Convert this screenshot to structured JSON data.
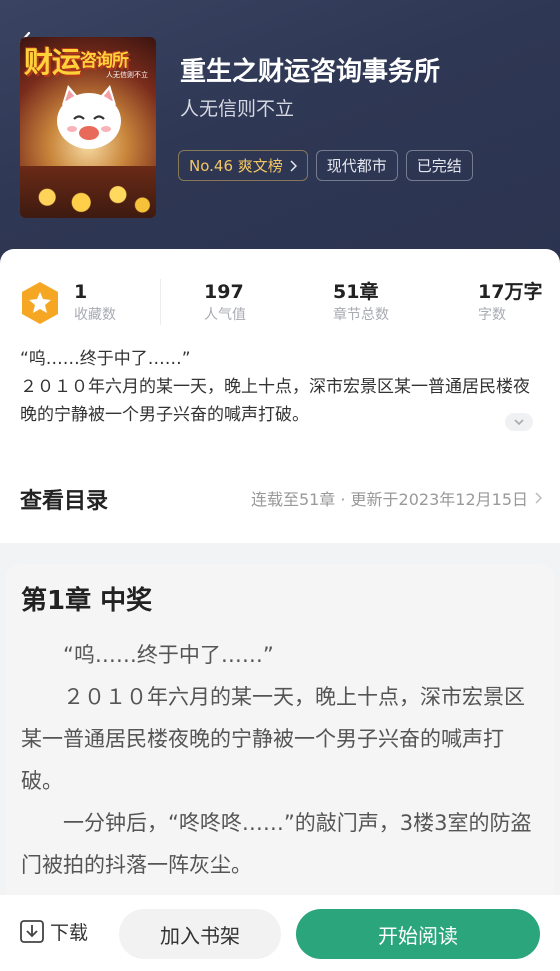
{
  "book": {
    "title": "重生之财运咨询事务所",
    "subtitle": "人无信则不立",
    "cover_title_main": "财运",
    "cover_title_small": "咨询所",
    "cover_tagline": "人无信则不立"
  },
  "tags": {
    "rank": "No.46 爽文榜",
    "genre": "现代都市",
    "status": "已完结"
  },
  "stats": {
    "favorites_value": "1",
    "favorites_label": "收藏数",
    "popularity_value": "197",
    "popularity_label": "人气值",
    "chapters_value": "51章",
    "chapters_label": "章节总数",
    "words_value": "17万字",
    "words_label": "字数"
  },
  "intro": {
    "line1": "“呜……终于中了……”",
    "line2": "２０１０年六月的某一天，晚上十点，深市宏景区某一普通居民楼夜晚的宁静被一个男子兴奋的喊声打破。"
  },
  "toc": {
    "title": "查看目录",
    "meta": "连载至51章 · 更新于2023年12月15日"
  },
  "chapter": {
    "title": "第1章 中奖",
    "p1": "“呜……终于中了……”",
    "p2": "２０１０年六月的某一天，晚上十点，深市宏景区某一普通居民楼夜晚的宁静被一个男子兴奋的喊声打破。",
    "p3": "一分钟后，“咚咚咚……”的敲门声，3楼3室的防盗门被拍的抖落一阵灰尘。"
  },
  "bottom_bar": {
    "download": "下载",
    "add_shelf": "加入书架",
    "start_reading": "开始阅读"
  },
  "colors": {
    "header_bg": "#2e3753",
    "accent_green": "#2aa57c",
    "badge_orange": "#f5a623",
    "rank_gold": "#f3c764"
  },
  "icons": [
    "back-arrow-icon",
    "chevron-right-icon",
    "star-badge-icon",
    "chevron-down-icon",
    "download-icon"
  ]
}
